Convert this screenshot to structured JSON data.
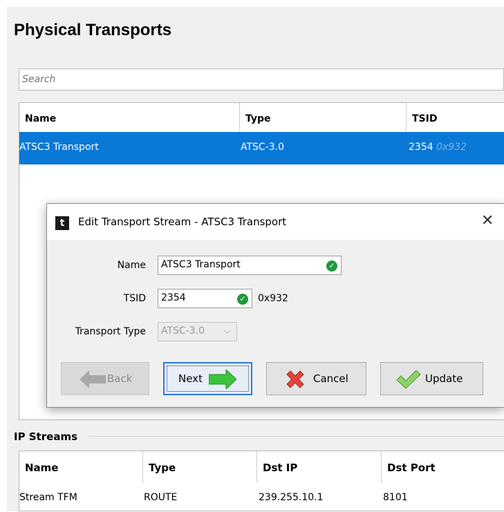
{
  "page": {
    "title": "Physical Transports"
  },
  "search": {
    "placeholder": "Search"
  },
  "transports": {
    "columns": [
      "Name",
      "Type",
      "TSID"
    ],
    "rows": [
      {
        "name": "ATSC3 Transport",
        "type": "ATSC-3.0",
        "tsid": "2354",
        "tsid_hex": "0x932"
      }
    ]
  },
  "dialog": {
    "title": "Edit Transport Stream - ATSC3 Transport",
    "icon_letter": "t",
    "close_glyph": "✕",
    "name_label": "Name",
    "name_value": "ATSC3 Transport",
    "tsid_label": "TSID",
    "tsid_value": "2354",
    "tsid_hex": "0x932",
    "type_label": "Transport Type",
    "type_value": "ATSC-3.0",
    "buttons": {
      "back": "Back",
      "next": "Next",
      "cancel": "Cancel",
      "update": "Update"
    }
  },
  "ip_streams": {
    "title": "IP Streams",
    "columns": [
      "Name",
      "Type",
      "Dst IP",
      "Dst Port"
    ],
    "rows": [
      {
        "name": "Stream TFM",
        "type": "ROUTE",
        "dst_ip": "239.255.10.1",
        "dst_port": "8101"
      }
    ]
  },
  "colors": {
    "selection": "#0a78d7",
    "check_green": "#1e9a3b",
    "arrow_green": "#3cc43c",
    "cancel_red": "#e0443a",
    "focus_blue": "#2b79d6"
  },
  "icons": [
    "check-icon",
    "back-arrow-icon",
    "next-arrow-icon",
    "cancel-x-icon",
    "update-check-icon",
    "app-icon",
    "close-icon",
    "chevron-down-icon"
  ]
}
